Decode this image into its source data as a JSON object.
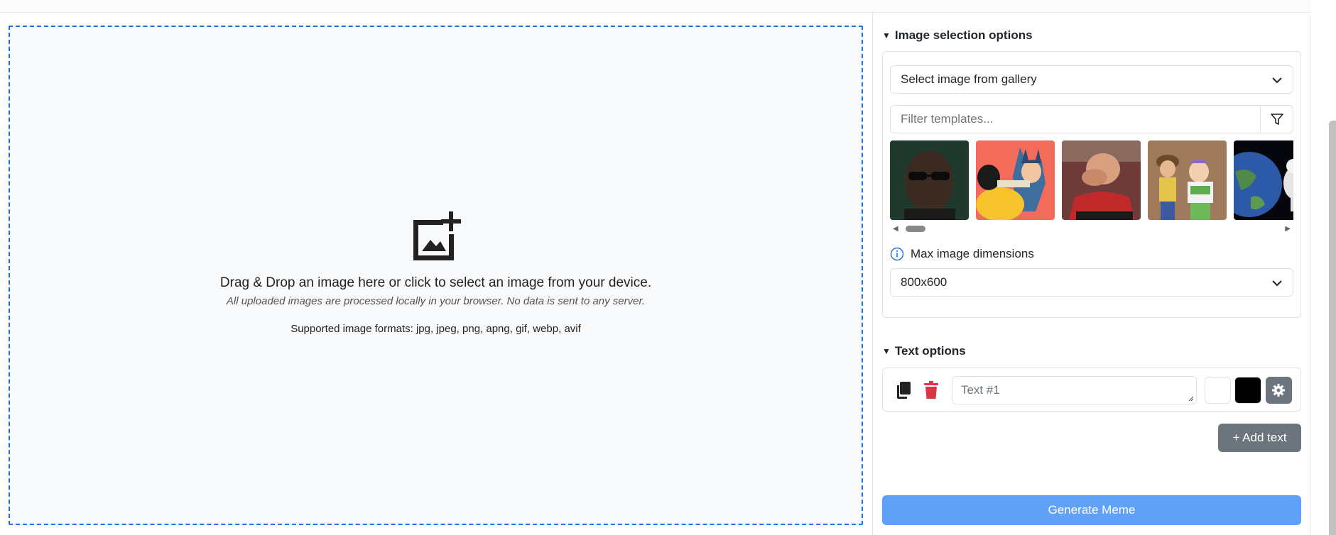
{
  "dropzone": {
    "main_text": "Drag & Drop an image here or click to select an image from your device.",
    "privacy_note": "All uploaded images are processed locally in your browser. No data is sent to any server.",
    "formats": "Supported image formats: jpg, jpeg, png, apng, gif, webp, avif"
  },
  "image_options": {
    "title": "Image selection options",
    "gallery_select": "Select image from gallery",
    "filter_placeholder": "Filter templates...",
    "thumbnails": [
      "matrix-morpheus",
      "batman-slapping-robin",
      "picard-facepalm",
      "buzz-and-woody",
      "astronaut-earth"
    ],
    "max_dim_label": "Max image dimensions",
    "max_dim_value": "800x600"
  },
  "text_options": {
    "title": "Text options",
    "text1_placeholder": "Text #1",
    "add_text_label": "+ Add text"
  },
  "generate_label": "Generate Meme",
  "colors": {
    "accent": "#1a73e8",
    "generate_bg": "#5ea1f7",
    "secondary": "#6c757d",
    "danger": "#dc3545"
  }
}
